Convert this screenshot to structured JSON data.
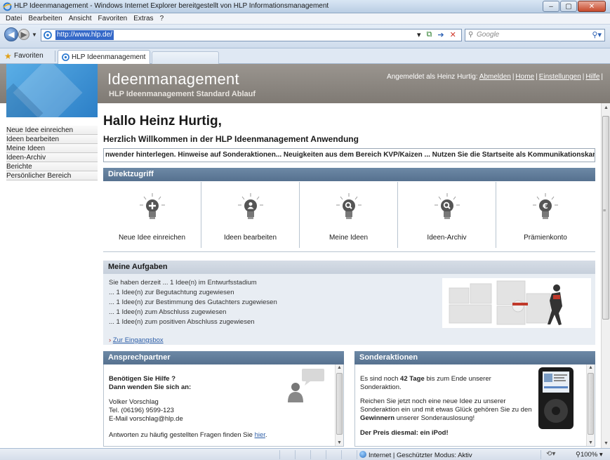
{
  "window": {
    "title": "HLP Ideenmanagement - Windows Internet Explorer bereitgestellt von HLP Informationsmanagement"
  },
  "menu": [
    "Datei",
    "Bearbeiten",
    "Ansicht",
    "Favoriten",
    "Extras",
    "?"
  ],
  "address": {
    "url": "http://www.hlp.de/",
    "search_placeholder": "Google"
  },
  "favorites": {
    "label": "Favoriten",
    "tab_label": "HLP Ideenmanagement"
  },
  "header": {
    "title": "Ideenmanagement",
    "subtitle": "HLP Ideenmanagement Standard Ablauf",
    "logged_in_text": "Angemeldet als Heinz Hurtig:",
    "links": [
      "Abmelden",
      "Home",
      "Einstellungen",
      "Hilfe"
    ]
  },
  "leftnav": [
    "Neue Idee einreichen",
    "Ideen bearbeiten",
    "Meine Ideen",
    "Ideen-Archiv",
    "Berichte",
    "Persönlicher Bereich"
  ],
  "main": {
    "greeting": "Hallo Heinz Hurtig,",
    "welcome": "Herzlich Willkommen in der HLP Ideenmanagement Anwendung",
    "ticker": "nwender hinterlegen. Hinweise auf Sonderaktionen... Neuigkeiten aus dem Bereich KVP/Kaizen ... Nutzen Sie die Startseite als Kommunikationskanal!"
  },
  "direktzugriff": {
    "title": "Direktzugriff",
    "items": [
      {
        "label": "Neue Idee einreichen",
        "icon": "plus-bulb-icon"
      },
      {
        "label": "Ideen bearbeiten",
        "icon": "person-bulb-icon"
      },
      {
        "label": "Meine Ideen",
        "icon": "search-bulb-icon"
      },
      {
        "label": "Ideen-Archiv",
        "icon": "search-bulb-icon"
      },
      {
        "label": "Prämienkonto",
        "icon": "euro-bulb-icon"
      }
    ]
  },
  "aufgaben": {
    "title": "Meine Aufgaben",
    "lines": [
      "Sie haben derzeit ... 1 Idee(n) im Entwurfsstadium",
      "... 1 Idee(n) zur Begutachtung zugewiesen",
      "... 1 Idee(n) zur Bestimmung des Gutachters zugewiesen",
      "... 1 Idee(n) zum Abschluss zugewiesen",
      "... 1 Idee(n) zum positiven Abschluss zugewiesen"
    ],
    "inbox_link": "Zur Eingangsbox"
  },
  "ansprechpartner": {
    "title": "Ansprechpartner",
    "heading1": "Benötigen Sie Hilfe ?",
    "heading2": "Dann wenden Sie sich an:",
    "name": "Volker Vorschlag",
    "phone": "Tel. (06196) 9599-123",
    "email": "E-Mail vorschlag@hlp.de",
    "faq_text": "Antworten zu häufig gestellten Fragen finden Sie",
    "faq_link": "hier"
  },
  "sonderaktionen": {
    "title": "Sonderaktionen",
    "line1_pre": "Es sind noch",
    "line1_days": "42 Tage",
    "line1_post": "bis zum Ende unserer",
    "line2": "Sonderaktion.",
    "line3": "Reichen Sie jetzt noch eine neue Idee zu unserer",
    "line4": "Sonderaktion ein und mit etwas Glück gehören Sie zu den",
    "line5_bold": "Gewinnern",
    "line5_post": "unserer Sonderauslosung!",
    "prize": "Der Preis diesmal: ein iPod!"
  },
  "status": {
    "zone": "Internet | Geschützter Modus: Aktiv",
    "zoom": "100%"
  },
  "colors": {
    "section_bar": "#5f7b99",
    "header_bg": "#8c8781",
    "logo_blue": "#3d93d6"
  }
}
